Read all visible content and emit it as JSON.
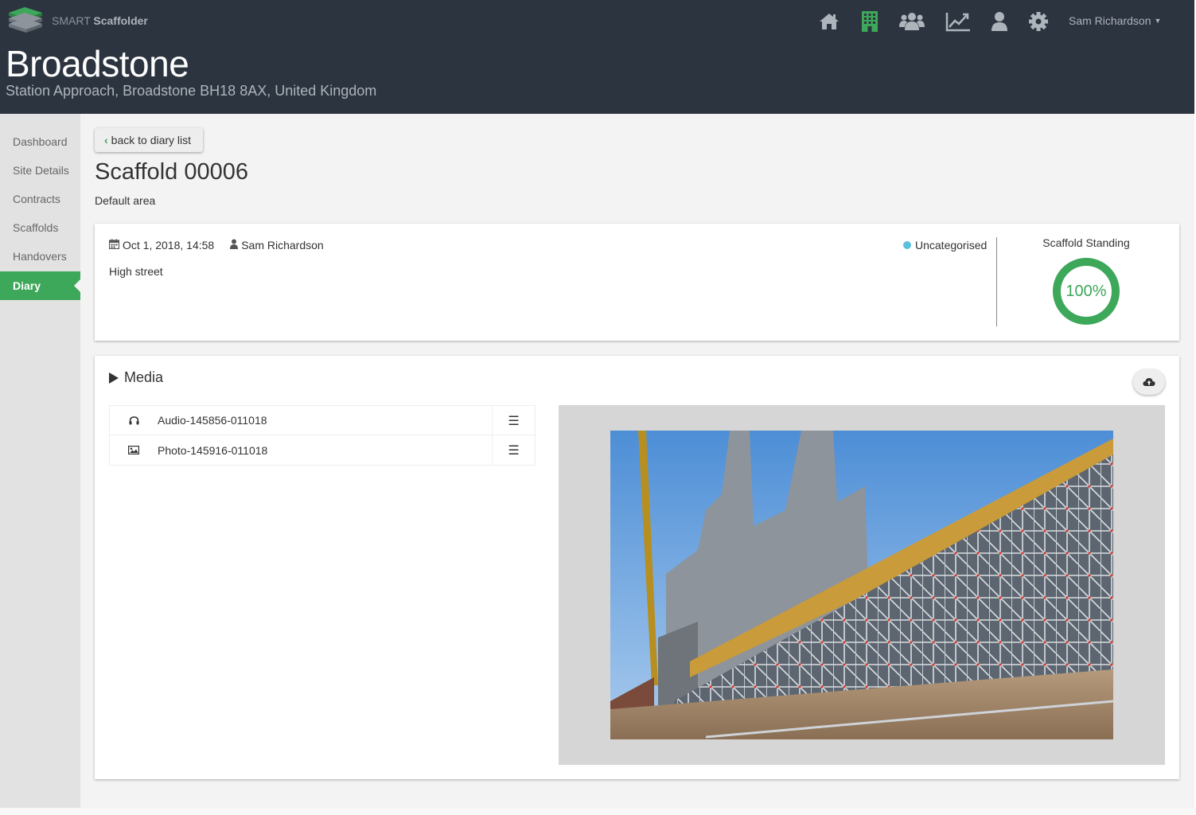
{
  "app": {
    "brand_light": "SMART",
    "brand_bold": "Scaffolder"
  },
  "site": {
    "name": "Broadstone",
    "address": "Station Approach, Broadstone BH18 8AX, United Kingdom"
  },
  "nav": {
    "icons": [
      "home-icon",
      "building-icon",
      "users-icon",
      "chart-line-icon",
      "user-icon",
      "gear-icon"
    ],
    "active_icon": "building-icon",
    "user_name": "Sam Richardson"
  },
  "sidebar": {
    "items": [
      {
        "label": "Dashboard"
      },
      {
        "label": "Site Details"
      },
      {
        "label": "Contracts"
      },
      {
        "label": "Scaffolds"
      },
      {
        "label": "Handovers"
      },
      {
        "label": "Diary"
      }
    ],
    "active": "Diary"
  },
  "page": {
    "back_label": "back to diary list",
    "title": "Scaffold 00006",
    "subtitle": "Default area"
  },
  "entry": {
    "date": "Oct 1, 2018, 14:58",
    "author": "Sam Richardson",
    "location": "High street",
    "category": "Uncategorised",
    "gauge_title": "Scaffold Standing",
    "gauge_value": 1.0,
    "gauge_label": "100%"
  },
  "media": {
    "title": "Media",
    "files": [
      {
        "type": "headphones-icon",
        "name": "Audio-145856-011018"
      },
      {
        "type": "image-icon",
        "name": "Photo-145916-011018"
      }
    ],
    "preview_alt": "scaffold-photo"
  },
  "colors": {
    "header_bg": "#2c3440",
    "accent_green": "#3da75a",
    "category_dot": "#5bc0de",
    "sidebar_bg": "#e2e2e2"
  }
}
